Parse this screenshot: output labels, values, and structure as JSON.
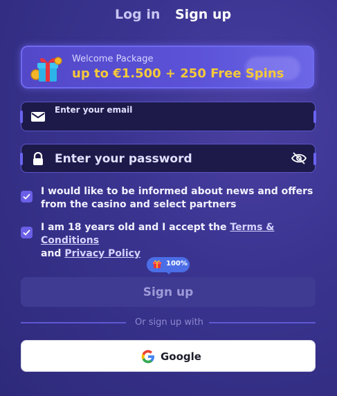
{
  "tabs": {
    "login": "Log in",
    "signup": "Sign up",
    "active": "signup"
  },
  "banner": {
    "subtitle": "Welcome Package",
    "offer": "up to €1.500 + 250 Free Spins",
    "icon": "gift-icon"
  },
  "form": {
    "email": {
      "placeholder": "Enter your email",
      "value": "",
      "icon": "envelope-icon"
    },
    "password": {
      "placeholder": "Enter your password",
      "value": "",
      "icon": "lock-icon",
      "toggle_icon": "eye-off-icon"
    }
  },
  "checkboxes": {
    "news": {
      "checked": true,
      "label": "I would like to be informed about news and offers from the casino and select partners"
    },
    "age": {
      "checked": true,
      "text_prefix": "I am 18 years old and I accept the ",
      "terms_link": "Terms & Conditions",
      "conjunction": "and ",
      "privacy_link": "Privacy Policy"
    }
  },
  "progress_badge": {
    "label": "100%",
    "progress_percent": 100
  },
  "signup_button": {
    "label": "Sign up"
  },
  "divider": {
    "label": "Or sign up with"
  },
  "google_button": {
    "label": "Google"
  },
  "colors": {
    "accent": "#6a5fe6",
    "offer_gold": "#f5c93a",
    "background": "#3a3490"
  }
}
